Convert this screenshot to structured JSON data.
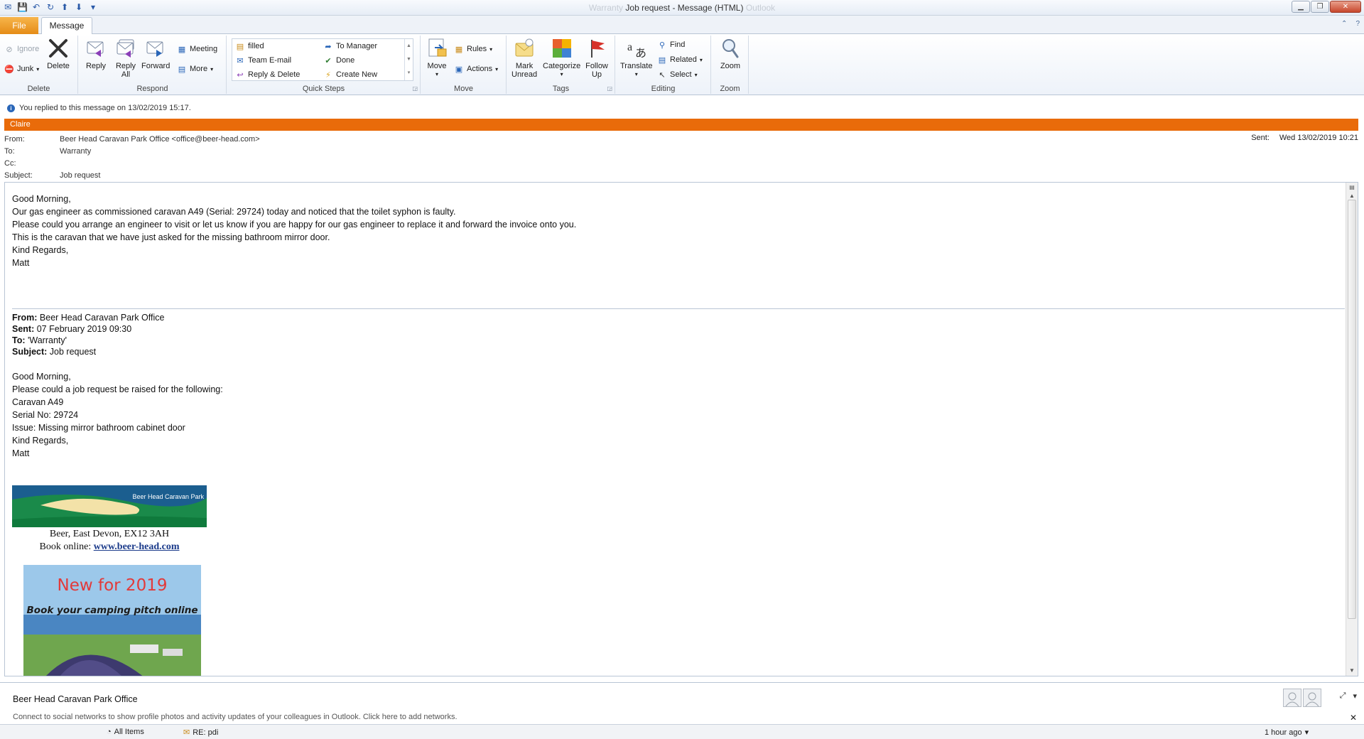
{
  "window": {
    "title": "Job request - Message (HTML)",
    "title_faded_left": "Warranty",
    "title_faded_right": "Outlook"
  },
  "tabs": {
    "file": "File",
    "message": "Message"
  },
  "ribbon": {
    "delete_group": {
      "label": "Delete",
      "ignore": "Ignore",
      "junk": "Junk",
      "delete": "Delete"
    },
    "respond_group": {
      "label": "Respond",
      "reply": "Reply",
      "reply_all_line1": "Reply",
      "reply_all_line2": "All",
      "forward": "Forward",
      "meeting": "Meeting",
      "more": "More"
    },
    "quick_steps_group": {
      "label": "Quick Steps",
      "items": [
        "filled",
        "Team E-mail",
        "Reply & Delete",
        "To Manager",
        "Done",
        "Create New"
      ]
    },
    "move_group": {
      "label": "Move",
      "move": "Move",
      "rules": "Rules",
      "actions": "Actions"
    },
    "tags_group": {
      "label": "Tags",
      "mark_unread_line1": "Mark",
      "mark_unread_line2": "Unread",
      "categorize": "Categorize",
      "follow_up_line1": "Follow",
      "follow_up_line2": "Up"
    },
    "editing_group": {
      "label": "Editing",
      "translate": "Translate",
      "find": "Find",
      "related": "Related",
      "select": "Select"
    },
    "zoom_group": {
      "label": "Zoom",
      "zoom": "Zoom"
    }
  },
  "infobar": {
    "text": "You replied to this message on 13/02/2019 15:17."
  },
  "category": {
    "name": "Claire",
    "color": "#e96b0a"
  },
  "headers": {
    "from_label": "From:",
    "from_value": "Beer Head Caravan Park Office <office@beer-head.com>",
    "to_label": "To:",
    "to_value": "Warranty",
    "cc_label": "Cc:",
    "cc_value": "",
    "subject_label": "Subject:",
    "subject_value": "Job request",
    "sent_label": "Sent:",
    "sent_value": "Wed 13/02/2019 10:21"
  },
  "body": {
    "lines": [
      "Good Morning,",
      "Our gas engineer as commissioned caravan A49 (Serial: 29724) today and noticed that the toilet syphon is faulty.",
      "Please could you arrange an engineer to visit or let us know if you are happy for our gas engineer to replace it and forward the invoice onto you.",
      "This is the caravan that we have just asked for the missing bathroom mirror door.",
      "Kind Regards,",
      "Matt"
    ],
    "quoted": {
      "from_label": "From:",
      "from_value": "Beer Head Caravan Park Office",
      "sent_label": "Sent:",
      "sent_value": "07 February 2019 09:30",
      "to_label": "To:",
      "to_value": "'Warranty'",
      "subject_label": "Subject:",
      "subject_value": "Job request",
      "lines": [
        "Good Morning,",
        "Please could a job request be raised for the following:",
        "Caravan A49",
        "Serial No: 29724",
        "Issue: Missing mirror bathroom cabinet door",
        "Kind Regards,",
        "Matt"
      ]
    },
    "signature": {
      "banner_text": "Beer Head Caravan Park",
      "address": "Beer, East Devon, EX12 3AH",
      "book_label": "Book online: ",
      "book_link": "www.beer-head.com",
      "promo_title": "New for 2019",
      "promo_sub": "Book your camping pitch online"
    }
  },
  "people_pane": {
    "name": "Beer Head Caravan Park Office",
    "note": "Connect to social networks to show profile photos and activity updates of your colleagues in Outlook. Click here to add networks."
  },
  "statusbar": {
    "all_items": "All Items",
    "re_item": "RE: pdi",
    "time": "1 hour ago"
  }
}
